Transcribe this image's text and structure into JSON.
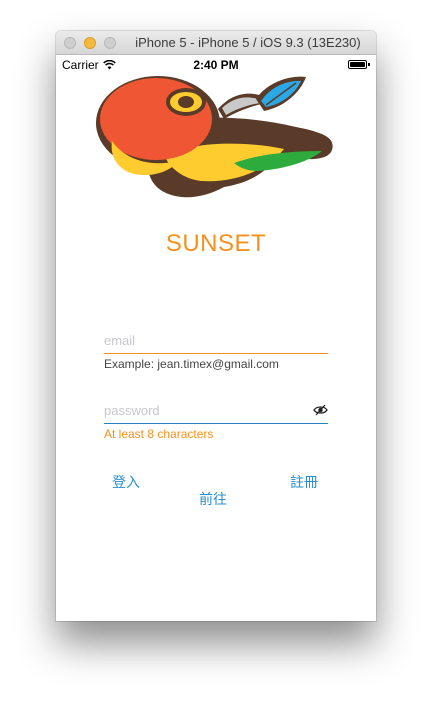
{
  "window": {
    "title": "iPhone 5 - iPhone 5 / iOS 9.3 (13E230)"
  },
  "statusbar": {
    "carrier": "Carrier",
    "time": "2:40 PM",
    "wifi_icon": "wifi-icon",
    "battery_icon": "battery-icon"
  },
  "app": {
    "logo_icon": "bower-bird-logo",
    "title": "SUNSET",
    "email": {
      "value": "",
      "placeholder": "email",
      "hint": "Example: jean.timex@gmail.com"
    },
    "password": {
      "value": "",
      "placeholder": "password",
      "hint": "At least 8 characters",
      "toggle_icon": "eye-slash-icon"
    },
    "buttons": {
      "login": "登入",
      "go": "前往",
      "register": "註冊"
    }
  },
  "colors": {
    "accent_orange": "#f7901e",
    "accent_blue": "#2a8ed0",
    "password_underline": "#2a7fc0"
  }
}
